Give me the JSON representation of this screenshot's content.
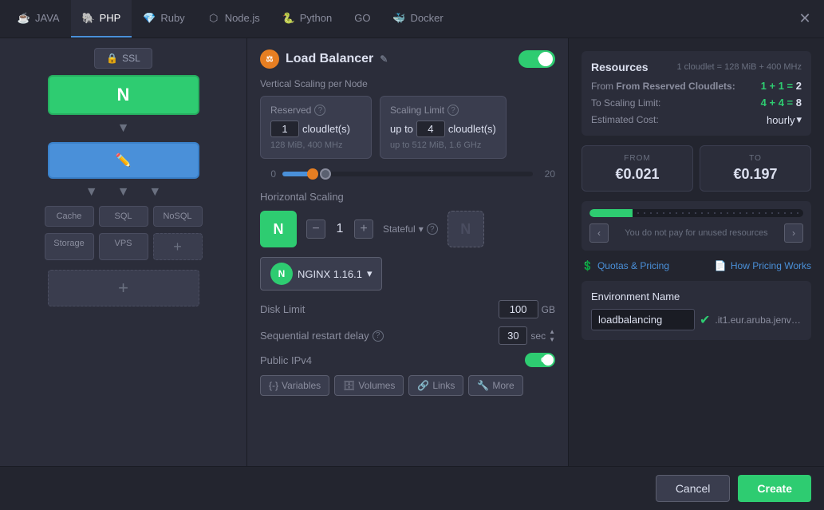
{
  "tabs": [
    {
      "id": "java",
      "label": "JAVA",
      "icon": "☕",
      "active": false
    },
    {
      "id": "php",
      "label": "PHP",
      "icon": "🐘",
      "active": true
    },
    {
      "id": "ruby",
      "label": "Ruby",
      "icon": "💎",
      "active": false
    },
    {
      "id": "nodejs",
      "label": "Node.js",
      "icon": "⬡",
      "active": false
    },
    {
      "id": "python",
      "label": "Python",
      "icon": "🐍",
      "active": false
    },
    {
      "id": "go",
      "label": "GO",
      "icon": "Go",
      "active": false
    },
    {
      "id": "docker",
      "label": "Docker",
      "icon": "🐳",
      "active": false
    }
  ],
  "left": {
    "ssl_label": "SSL",
    "node_icon": "N",
    "cache_label": "Cache",
    "sql_label": "SQL",
    "nosql_label": "NoSQL",
    "storage_label": "Storage",
    "vps_label": "VPS"
  },
  "middle": {
    "title": "Load Balancer",
    "toggle_on": "ON",
    "vertical_scaling_label": "Vertical Scaling per Node",
    "reserved_label": "Reserved",
    "reserved_value": "1",
    "cloudlets_unit": "cloudlet(s)",
    "reserved_mhz": "128 MiB, 400 MHz",
    "scaling_limit_label": "Scaling Limit",
    "scaling_up_to": "up to",
    "scaling_value": "4",
    "scaling_max": "up to 512 MiB, 1.6 GHz",
    "slider_min": "0",
    "slider_max": "20",
    "horizontal_scaling_label": "Horizontal Scaling",
    "stepper_value": "1",
    "stateful_label": "Stateful",
    "nginx_version": "NGINX 1.16.1",
    "disk_limit_label": "Disk Limit",
    "disk_value": "100",
    "disk_unit": "GB",
    "restart_delay_label": "Sequential restart delay",
    "restart_help": "?",
    "restart_value": "30",
    "restart_unit": "sec",
    "ipv4_label": "Public IPv4",
    "ipv4_toggle": "ON",
    "btn_variables": "Variables",
    "btn_volumes": "Volumes",
    "btn_links": "Links",
    "btn_more": "More"
  },
  "right": {
    "resources_title": "Resources",
    "resources_info": "1 cloudlet = 128 MiB + 400 MHz",
    "from_label": "From Reserved Cloudlets:",
    "from_value": "1 + 1 =",
    "from_bold": "2",
    "to_label": "To Scaling Limit:",
    "to_value": "4 + 4 =",
    "to_bold": "8",
    "estimated_label": "Estimated Cost:",
    "estimated_val": "hourly",
    "price_from_header": "FROM",
    "price_from_val": "€0.021",
    "price_to_header": "TO",
    "price_to_val": "€0.197",
    "progress_info": "You do not pay for unused resources",
    "quotas_label": "Quotas & Pricing",
    "pricing_label": "How Pricing Works",
    "env_name_title": "Environment Name",
    "env_name_value": "loadbalancing",
    "env_domain": ".it1.eur.aruba.jenv-a...",
    "btn_cancel": "Cancel",
    "btn_create": "Create"
  }
}
